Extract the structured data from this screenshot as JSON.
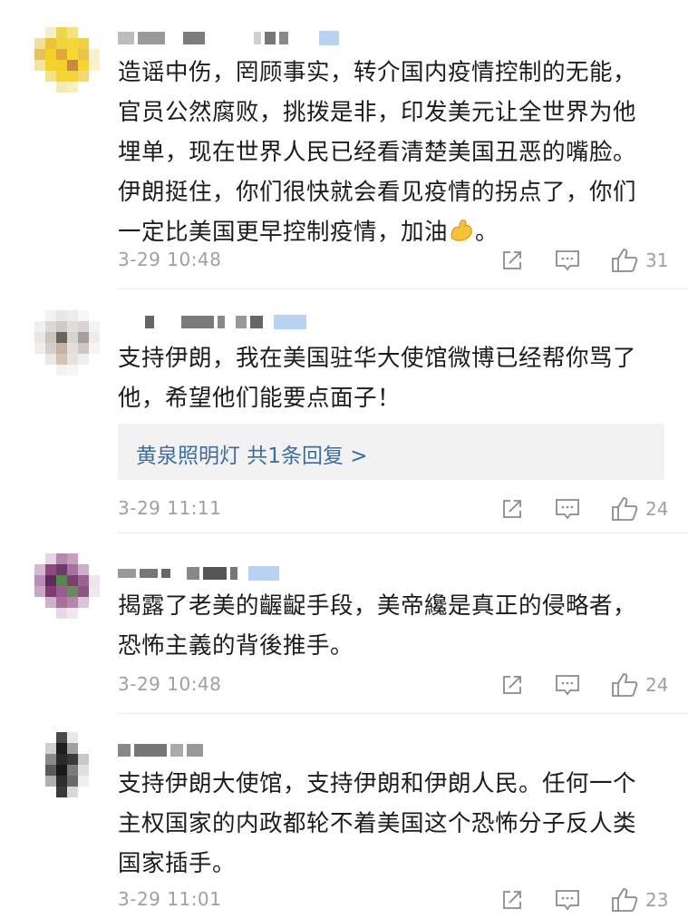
{
  "colors": {
    "text": "#1c1c1c",
    "meta": "#a0a0a0",
    "link": "#3d6e9e",
    "reply_bg": "#f2f2f2",
    "badge": "#b8d4f2"
  },
  "comments": [
    {
      "text": "造谣中伤，罔顾事实，转介国内疫情控制的无能，\n官员公然腐败，挑拨是非，印发美元让全世界为他\n埋单，现在世界人民已经看清楚美国丑恶的嘴脸。\n伊朗挺住，你们很快就会看见疫情的拐点了，你们\n一定比美国更早控制疫情，加油",
      "text_suffix": "。",
      "emoji": "flexed-biceps-emoji",
      "time": "3-29 10:48",
      "likes": "31"
    },
    {
      "text": "支持伊朗，我在美国驻华大使馆微博已经帮你骂了\n他，希望他们能要点面子！",
      "reply": "黄泉照明灯  共1条回复 >",
      "time": "3-29 11:11",
      "likes": "24"
    },
    {
      "text": "揭露了老美的齷齪手段，美帝纔是真正的侵略者，\n恐怖主義的背後推手。",
      "time": "3-29 10:48",
      "likes": "24"
    },
    {
      "text": "支持伊朗大使馆，支持伊朗和伊朗人民。任何一个\n主权国家的内政都轮不着美国这个恐怖分子反人类\n国家插手。",
      "time": "3-29 11:01",
      "likes": "23"
    }
  ],
  "icons": {
    "share": "share-icon",
    "comment": "comment-icon",
    "like": "thumbs-up-icon"
  }
}
